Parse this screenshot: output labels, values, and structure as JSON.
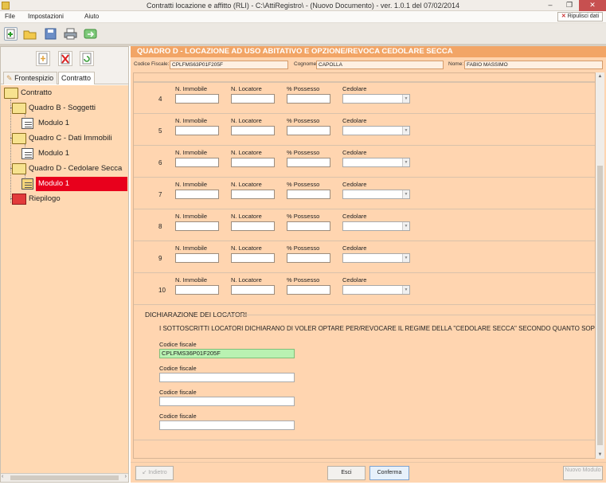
{
  "window": {
    "title": "Contratti locazione e affitto (RLI) - C:\\AttiRegistro\\ - (Nuovo Documento)  -  ver. 1.0.1 del 07/02/2014",
    "minimize": "–",
    "restore": "❐",
    "close": "✕"
  },
  "menu": {
    "file": "File",
    "impostazioni": "Impostazioni",
    "aiuto": "Aiuto",
    "ripulisci": "Ripulisci dati"
  },
  "tabs": {
    "frontespizio": "Frontespizio",
    "contratto": "Contratto"
  },
  "tree": {
    "root": "Contratto",
    "quadro_b": "Quadro B - Soggetti",
    "quadro_b_mod": "Modulo 1",
    "quadro_c": "Quadro C - Dati Immobili",
    "quadro_c_mod": "Modulo 1",
    "quadro_d": "Quadro D - Cedolare Secca",
    "quadro_d_mod": "Modulo 1",
    "riepilogo": "Riepilogo"
  },
  "main": {
    "header": "QUADRO D - LOCAZIONE AD USO ABITATIVO E OPZIONE/REVOCA CEDOLARE SECCA",
    "codice_fiscale_label": "Codice Fiscale:",
    "codice_fiscale_value": "CPLFMS63P01F205F",
    "cognome_label": "Cognome:",
    "cognome_value": "CAPOLLA",
    "nome_label": "Nome:",
    "nome_value": "FABIO MASSIMO"
  },
  "fields": {
    "immobile": "N. Immobile",
    "locatore": "N. Locatore",
    "possesso": "% Possesso",
    "cedolare": "Cedolare"
  },
  "rows": [
    "4",
    "5",
    "6",
    "7",
    "8",
    "9",
    "10"
  ],
  "declaration": {
    "title": "DICHIARAZIONE DEI LOCATORI",
    "text": "I SOTTOSCRITTI LOCATORI DICHIARANO DI VOLER OPTARE PER/REVOCARE IL REGIME DELLA \"CEDOLARE SECCA\" SECONDO QUANTO SOPRA INDI",
    "cf_label": "Codice fiscale",
    "cf_values": [
      "CPLFMS36P01F205F",
      "",
      "",
      ""
    ]
  },
  "buttons": {
    "indietro": "Indietro",
    "esci": "Esci",
    "conferma": "Conferma",
    "nuovo_modulo": "Nuovo Modulo"
  }
}
